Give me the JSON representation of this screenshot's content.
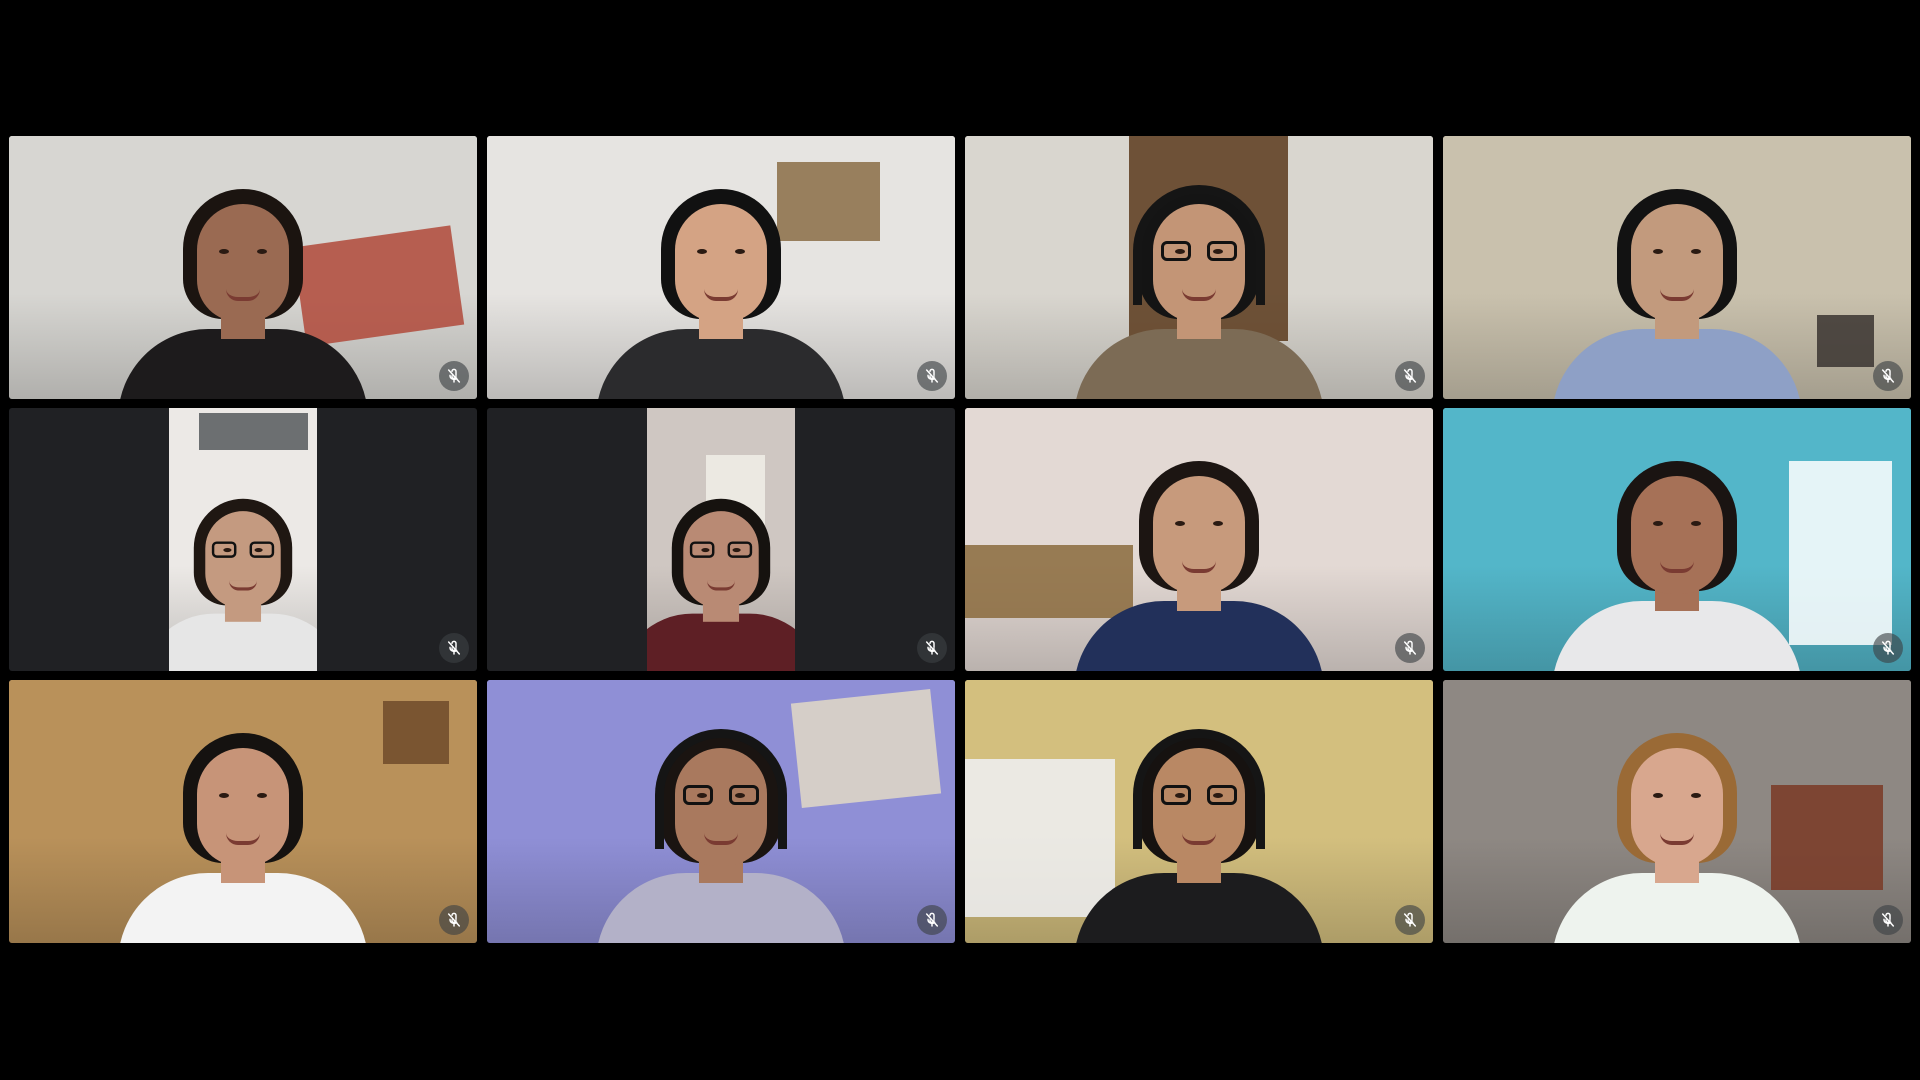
{
  "meeting": {
    "layout": "grid",
    "participants": [
      {
        "mic": "muted",
        "mic_icon": "mic-off-icon",
        "bg": "#d7d6d2",
        "accent": "#b0493a",
        "skin": "#9a6a52",
        "hair": "#1b1410",
        "top": "#1d1b1c",
        "glasses": false,
        "headphones": false,
        "letterboxed": false
      },
      {
        "mic": "muted",
        "mic_icon": "mic-off-icon",
        "bg": "#e6e4e1",
        "accent": "#8a6d45",
        "skin": "#d4a384",
        "hair": "#111111",
        "top": "#2b2b2d",
        "glasses": false,
        "headphones": false,
        "letterboxed": false
      },
      {
        "mic": "muted",
        "mic_icon": "mic-off-icon",
        "bg": "#d9d6cf",
        "accent": "#5b3a1c",
        "skin": "#c39576",
        "hair": "#141414",
        "top": "#7c6b55",
        "glasses": true,
        "headphones": true,
        "letterboxed": false
      },
      {
        "mic": "muted",
        "mic_icon": "mic-off-icon",
        "bg": "#c9c1ad",
        "accent": "#3a3430",
        "skin": "#c29a7d",
        "hair": "#121212",
        "top": "#8ea0c6",
        "glasses": false,
        "headphones": false,
        "letterboxed": false
      },
      {
        "mic": "muted",
        "mic_icon": "mic-off-icon",
        "bg": "#ece9e6",
        "accent": "#56595c",
        "skin": "#c49a80",
        "hair": "#1f1712",
        "top": "#e6e6e6",
        "glasses": true,
        "headphones": false,
        "letterboxed": true
      },
      {
        "mic": "muted",
        "mic_icon": "mic-off-icon",
        "bg": "#cfc7c2",
        "accent": "#f1efe8",
        "skin": "#b98a74",
        "hair": "#16120f",
        "top": "#5e1f25",
        "glasses": true,
        "headphones": false,
        "letterboxed": true
      },
      {
        "mic": "muted",
        "mic_icon": "mic-off-icon",
        "bg": "#e3d9d4",
        "accent": "#8a6a3c",
        "skin": "#c79a7c",
        "hair": "#1c1512",
        "top": "#22305a",
        "glasses": false,
        "headphones": false,
        "letterboxed": false
      },
      {
        "mic": "muted",
        "mic_icon": "mic-off-icon",
        "bg": "#53b6c9",
        "accent": "#ffffff",
        "skin": "#a67157",
        "hair": "#1a1412",
        "top": "#e8e8ea",
        "glasses": false,
        "headphones": false,
        "letterboxed": false
      },
      {
        "mic": "muted",
        "mic_icon": "mic-off-icon",
        "bg": "#b9915a",
        "accent": "#6f4a2a",
        "skin": "#c79478",
        "hair": "#151210",
        "top": "#f3f3f3",
        "glasses": false,
        "headphones": false,
        "letterboxed": false
      },
      {
        "mic": "muted",
        "mic_icon": "mic-off-icon",
        "bg": "#8f8fd6",
        "accent": "#e2d9c6",
        "skin": "#a9795e",
        "hair": "#1a1411",
        "top": "#b3b1c8",
        "glasses": true,
        "headphones": true,
        "letterboxed": false
      },
      {
        "mic": "muted",
        "mic_icon": "mic-off-icon",
        "bg": "#d3bf7e",
        "accent": "#eef0f4",
        "skin": "#b98864",
        "hair": "#161210",
        "top": "#1c1c1e",
        "glasses": true,
        "headphones": true,
        "letterboxed": false
      },
      {
        "mic": "muted",
        "mic_icon": "mic-off-icon",
        "bg": "#8e8883",
        "accent": "#7a3a26",
        "skin": "#d8a78e",
        "hair": "#9a6a36",
        "top": "#eef3ee",
        "glasses": false,
        "headphones": false,
        "letterboxed": false
      }
    ]
  },
  "colors": {
    "page_background": "#000000",
    "tile_background": "#202124",
    "mute_badge": "#3c4043",
    "mute_glyph": "#ffffff"
  }
}
